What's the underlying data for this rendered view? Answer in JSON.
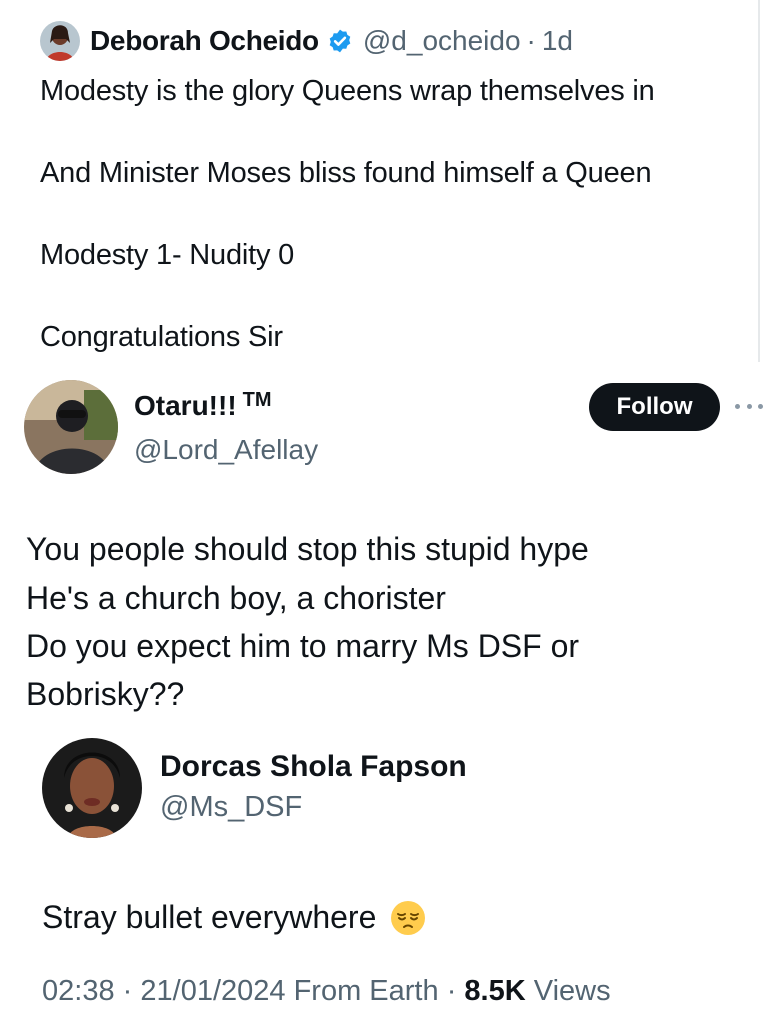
{
  "quoted_tweet": {
    "author_name": "Deborah Ocheido",
    "author_handle": "@d_ocheido",
    "separator": "·",
    "time": "1d",
    "lines": [
      "Modesty is the glory Queens wrap themselves in",
      "And Minister Moses bliss found himself a Queen",
      "Modesty 1- Nudity 0",
      "Congratulations Sir"
    ]
  },
  "main_tweet": {
    "author_name": "Otaru!!!",
    "trademark": "TM",
    "author_handle": "@Lord_Afellay",
    "follow_label": "Follow",
    "lines": [
      "You people should stop this stupid hype",
      "He's a church boy, a chorister",
      "Do you expect him to marry Ms DSF or",
      "Bobrisky??"
    ]
  },
  "embedded_tweet": {
    "author_name": "Dorcas Shola Fapson",
    "author_handle": "@Ms_DSF",
    "text": "Stray bullet everywhere",
    "emoji": "pensive-face-icon"
  },
  "meta": {
    "time": "02:38",
    "separator": "·",
    "date": "21/01/2024",
    "source": "From Earth",
    "views_count": "8.5K",
    "views_label": "Views"
  },
  "colors": {
    "text_primary": "#0f1419",
    "text_secondary": "#536471",
    "verified_blue": "#1d9bf0",
    "follow_bg": "#0f1419"
  }
}
